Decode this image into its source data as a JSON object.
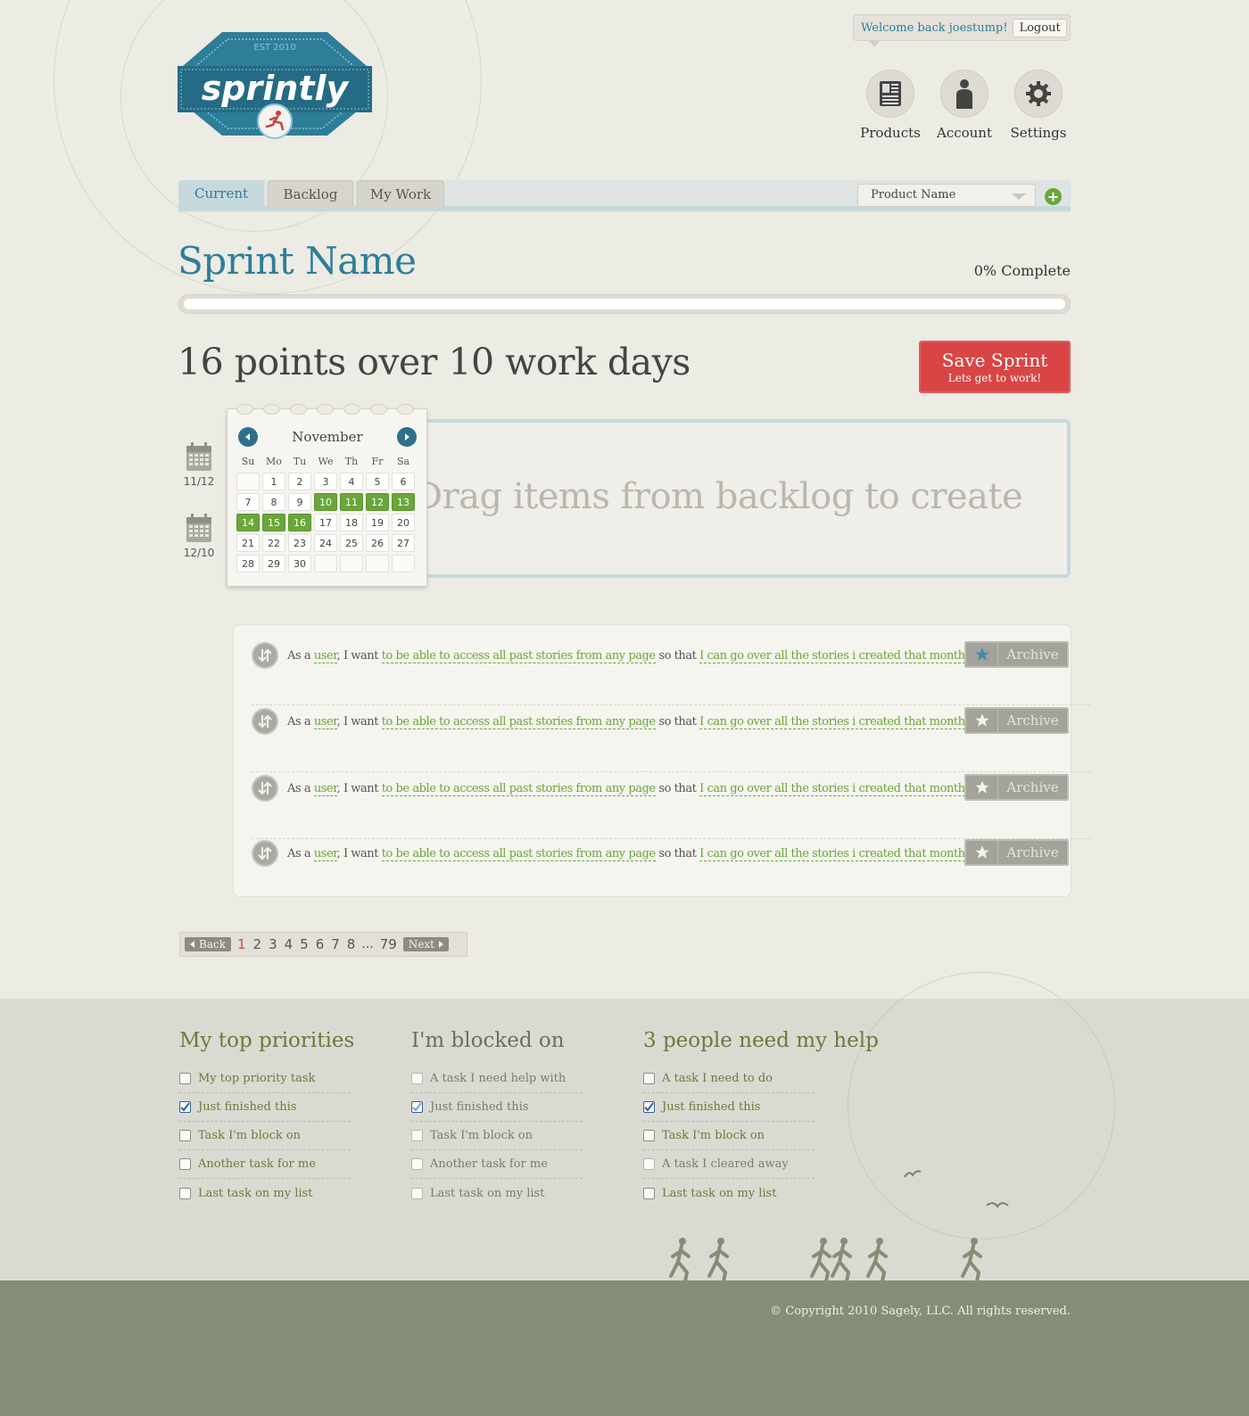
{
  "brand": {
    "name": "sprintly",
    "established": "EST 2010"
  },
  "header": {
    "welcome": "Welcome back joestump!",
    "logout": "Logout",
    "nav": [
      {
        "label": "Products",
        "icon": "products-icon"
      },
      {
        "label": "Account",
        "icon": "account-icon"
      },
      {
        "label": "Settings",
        "icon": "gear-icon"
      }
    ]
  },
  "tabs": {
    "current": "Current",
    "backlog": "Backlog",
    "mywork": "My Work"
  },
  "product_select": {
    "value": "Product Name"
  },
  "sprint": {
    "name": "Sprint Name",
    "complete": "0% Complete",
    "progress_percent": 0,
    "points": "16 points over 10 work days",
    "save_title": "Save Sprint",
    "save_sub": "Lets get to work!",
    "start_date": "11/12",
    "end_date": "12/10",
    "drop_text": "Drag items from backlog to create"
  },
  "calendar": {
    "month": "November",
    "dows": [
      "Su",
      "Mo",
      "Tu",
      "We",
      "Th",
      "Fr",
      "Sa"
    ],
    "days": [
      "",
      "1",
      "2",
      "3",
      "4",
      "5",
      "6",
      "7",
      "8",
      "9",
      "10",
      "11",
      "12",
      "13",
      "14",
      "15",
      "16",
      "17",
      "18",
      "19",
      "20",
      "21",
      "22",
      "23",
      "24",
      "25",
      "26",
      "27",
      "28",
      "29",
      "30",
      "",
      "",
      "",
      ""
    ],
    "selected": [
      "10",
      "11",
      "12",
      "13",
      "14",
      "15",
      "16"
    ]
  },
  "stories": [
    {
      "prefix": "As a",
      "role": "user",
      "want": ", I want",
      "goal": "to be able to access all past stories from any page",
      "so": "so that",
      "reason": "I can go over all the stories i created that month",
      "end": ".",
      "archive": "Archive",
      "starred": true
    },
    {
      "prefix": "As a",
      "role": "user",
      "want": ", I want",
      "goal": "to be able to access all past stories from any page",
      "so": "so that",
      "reason": "I can go over all the stories i created that month",
      "end": ".",
      "archive": "Archive",
      "starred": false
    },
    {
      "prefix": "As a",
      "role": "user",
      "want": ", I want",
      "goal": "to be able to access all past stories from any page",
      "so": "so that",
      "reason": "I can go over all the stories i created that month",
      "end": ".",
      "archive": "Archive",
      "starred": false
    },
    {
      "prefix": "As a",
      "role": "user",
      "want": ", I want",
      "goal": "to be able to access all past stories from any page",
      "so": "so that",
      "reason": "I can go over all the stories i created that month",
      "end": ".",
      "archive": "Archive",
      "starred": false
    }
  ],
  "pagination": {
    "back": "Back",
    "pages": [
      "1",
      "2",
      "3",
      "4",
      "5",
      "6",
      "7",
      "8"
    ],
    "current": "1",
    "ellipsis": "...",
    "last": "79",
    "next": "Next"
  },
  "footer": {
    "columns": [
      {
        "title": "My top priorities",
        "tasks": [
          {
            "label": "My top priority task",
            "checked": false
          },
          {
            "label": "Just finished this",
            "checked": true
          },
          {
            "label": "Task I'm block on",
            "checked": false
          },
          {
            "label": "Another task for me",
            "checked": false
          },
          {
            "label": "Last task on my list",
            "checked": false
          }
        ]
      },
      {
        "title": "I'm blocked on",
        "tasks": [
          {
            "label": "A task I need help with",
            "checked": false
          },
          {
            "label": "Just finished this",
            "checked": true
          },
          {
            "label": "Task I'm block on",
            "checked": false
          },
          {
            "label": "Another task for me",
            "checked": false
          },
          {
            "label": "Last task on my list",
            "checked": false
          }
        ]
      },
      {
        "title": "3 people need my help",
        "tasks": [
          {
            "label": "A task I need to do",
            "checked": false
          },
          {
            "label": "Just finished this",
            "checked": true
          },
          {
            "label": "Task I'm block on",
            "checked": false
          },
          {
            "label": "A task I cleared away",
            "checked": false
          },
          {
            "label": "Last task on my list",
            "checked": false
          }
        ]
      }
    ],
    "copyright": "© Copyright 2010 Sagely, LLC. All rights reserved."
  },
  "colors": {
    "accent_blue": "#2e7d99",
    "accent_green": "#6aa63a",
    "save_red": "#d94545",
    "ground": "#868d77"
  }
}
